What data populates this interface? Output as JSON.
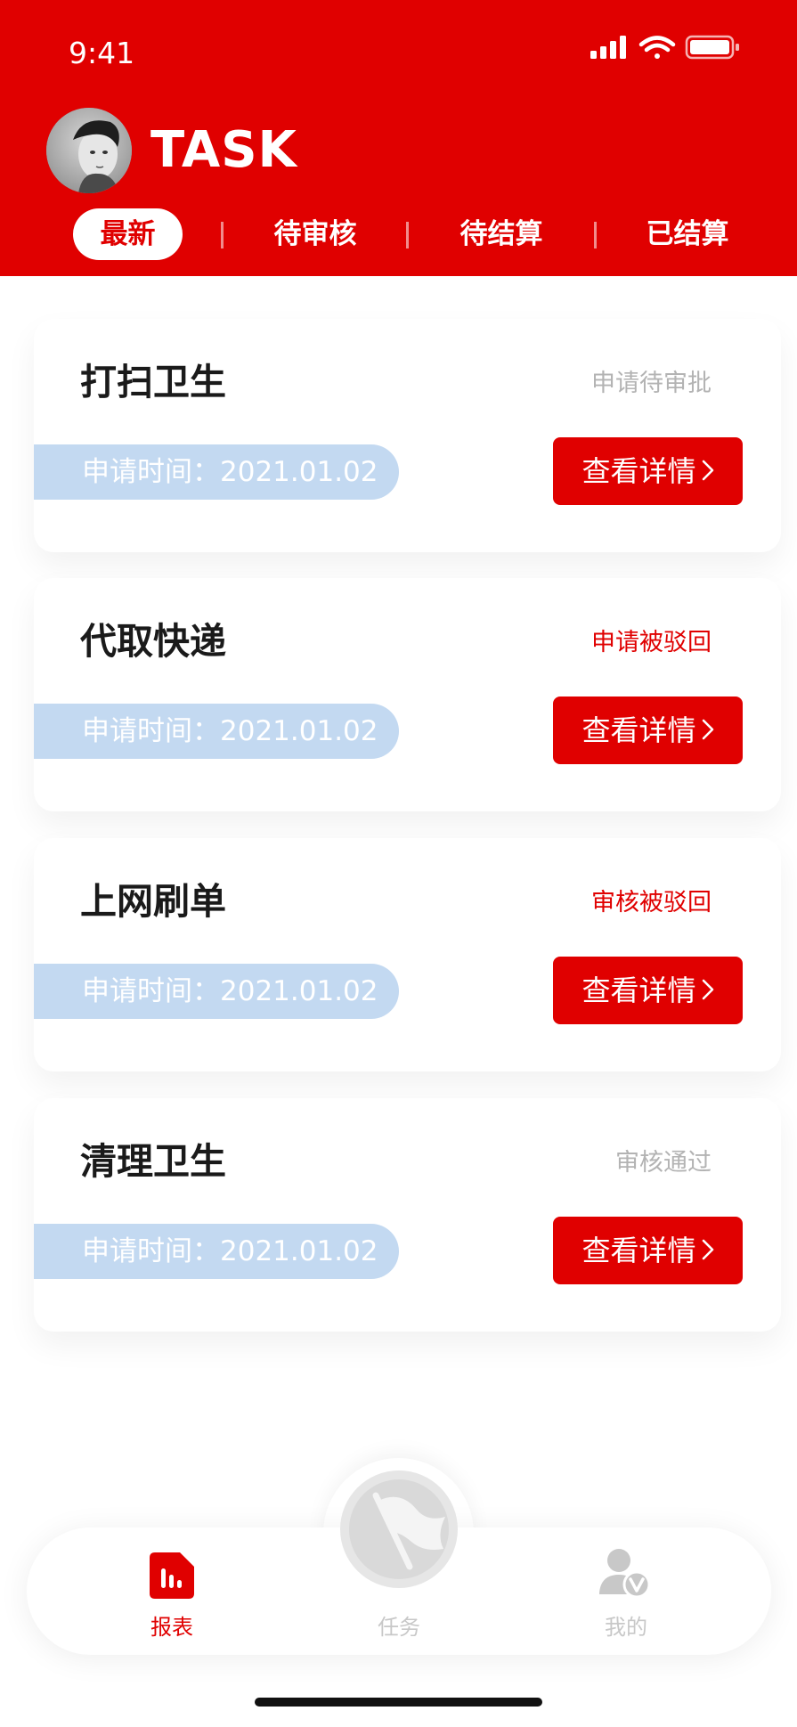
{
  "status_bar": {
    "time": "9:41"
  },
  "header": {
    "title": "TASK",
    "tabs": [
      "最新",
      "待审核",
      "待结算",
      "已结算"
    ],
    "active_tab": "最新",
    "accent_color": "#e00000"
  },
  "cards": [
    {
      "title": "打扫卫生",
      "status": "申请待审批",
      "status_color": "#b3b3b3",
      "date": "申请时间：2021.01.02",
      "button": "查看详情"
    },
    {
      "title": "代取快递",
      "status": "申请被驳回",
      "status_color": "#e00000",
      "date": "申请时间：2021.01.02",
      "button": "查看详情"
    },
    {
      "title": "上网刷单",
      "status": "审核被驳回",
      "status_color": "#e00000",
      "date": "申请时间：2021.01.02",
      "button": "查看详情"
    },
    {
      "title": "清理卫生",
      "status": "审核通过",
      "status_color": "#b3b3b3",
      "date": "申请时间：2021.01.02",
      "button": "查看详情"
    }
  ],
  "bottom_nav": {
    "items": [
      {
        "label": "报表",
        "icon": "report-icon",
        "active": true
      },
      {
        "label": "任务",
        "icon": "flag-icon",
        "active": false
      },
      {
        "label": "我的",
        "icon": "user-verified-icon",
        "active": false
      }
    ],
    "active_color": "#e00000",
    "inactive_color": "#c8c8c8"
  }
}
